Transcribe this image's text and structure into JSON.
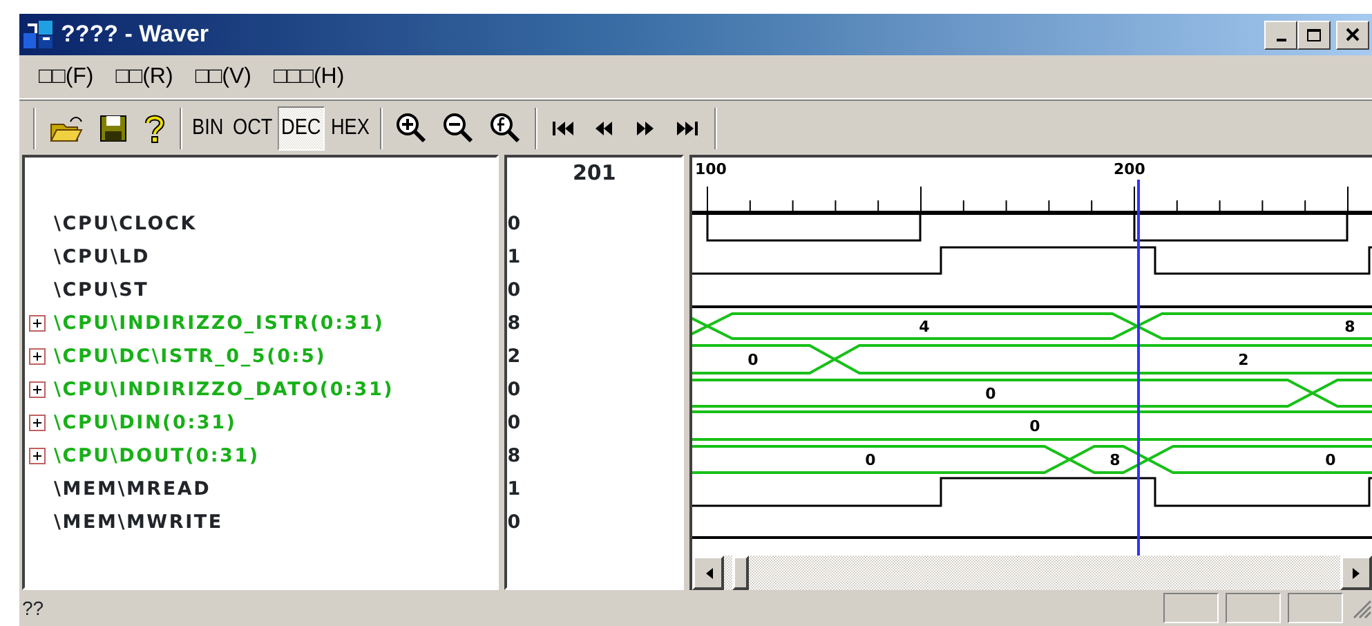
{
  "window": {
    "title": "???? - Waver"
  },
  "menu": [
    {
      "label": "□□(F)"
    },
    {
      "label": "□□(R)"
    },
    {
      "label": "□□(V)"
    },
    {
      "label": "□□□(H)"
    }
  ],
  "radix": [
    {
      "label": "BIN",
      "selected": false
    },
    {
      "label": "OCT",
      "selected": false
    },
    {
      "label": "DEC",
      "selected": true
    },
    {
      "label": "HEX",
      "selected": false
    }
  ],
  "time_ruler": {
    "labels": [
      "100",
      "200"
    ]
  },
  "cursor": {
    "time": "201"
  },
  "signals": [
    {
      "name": "\\CPU\\CLOCK",
      "kind": "bit",
      "value": "0"
    },
    {
      "name": "\\CPU\\LD",
      "kind": "bit",
      "value": "1"
    },
    {
      "name": "\\CPU\\ST",
      "kind": "bit",
      "value": "0"
    },
    {
      "name": "\\CPU\\INDIRIZZO_ISTR(0:31)",
      "kind": "bus",
      "expanded": false,
      "value": "8",
      "wave_labels": [
        "4",
        "8"
      ]
    },
    {
      "name": "\\CPU\\DC\\ISTR_0_5(0:5)",
      "kind": "bus",
      "expanded": false,
      "value": "2",
      "wave_labels": [
        "0",
        "2"
      ]
    },
    {
      "name": "\\CPU\\INDIRIZZO_DATO(0:31)",
      "kind": "bus",
      "expanded": false,
      "value": "0",
      "wave_labels": [
        "0"
      ]
    },
    {
      "name": "\\CPU\\DIN(0:31)",
      "kind": "bus",
      "expanded": false,
      "value": "0",
      "wave_labels": [
        "0"
      ]
    },
    {
      "name": "\\CPU\\DOUT(0:31)",
      "kind": "bus",
      "expanded": false,
      "value": "8",
      "wave_labels": [
        "0",
        "8",
        "0"
      ]
    },
    {
      "name": "\\MEM\\MREAD",
      "kind": "bit",
      "value": "1"
    },
    {
      "name": "\\MEM\\MWRITE",
      "kind": "bit",
      "value": "0"
    }
  ],
  "status_bar": {
    "text": "??"
  }
}
